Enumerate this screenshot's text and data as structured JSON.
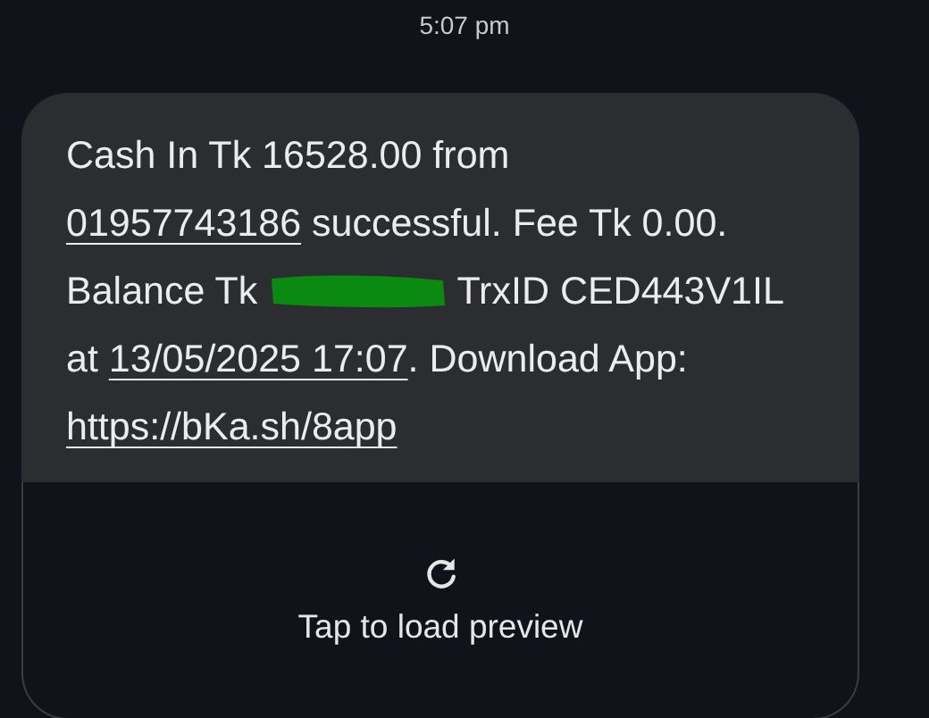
{
  "timestamp": "5:07 pm",
  "message": {
    "lines": [
      [
        {
          "kind": "text",
          "text": "Cash In Tk 16528.00 from"
        }
      ],
      [
        {
          "kind": "link",
          "text": "01957743186"
        },
        {
          "kind": "text",
          "text": " successful. Fee Tk 0.00."
        }
      ],
      [
        {
          "kind": "text",
          "text": "Balance Tk "
        },
        {
          "kind": "redacted"
        },
        {
          "kind": "text",
          "text": " TrxID CED443V1IL"
        }
      ],
      [
        {
          "kind": "text",
          "text": "at "
        },
        {
          "kind": "link",
          "text": "13/05/2025 17:07"
        },
        {
          "kind": "text",
          "text": ". Download App:"
        }
      ],
      [
        {
          "kind": "link",
          "text": "https://bKa.sh/8app"
        }
      ]
    ]
  },
  "link_preview": {
    "label": "Tap to load preview"
  }
}
